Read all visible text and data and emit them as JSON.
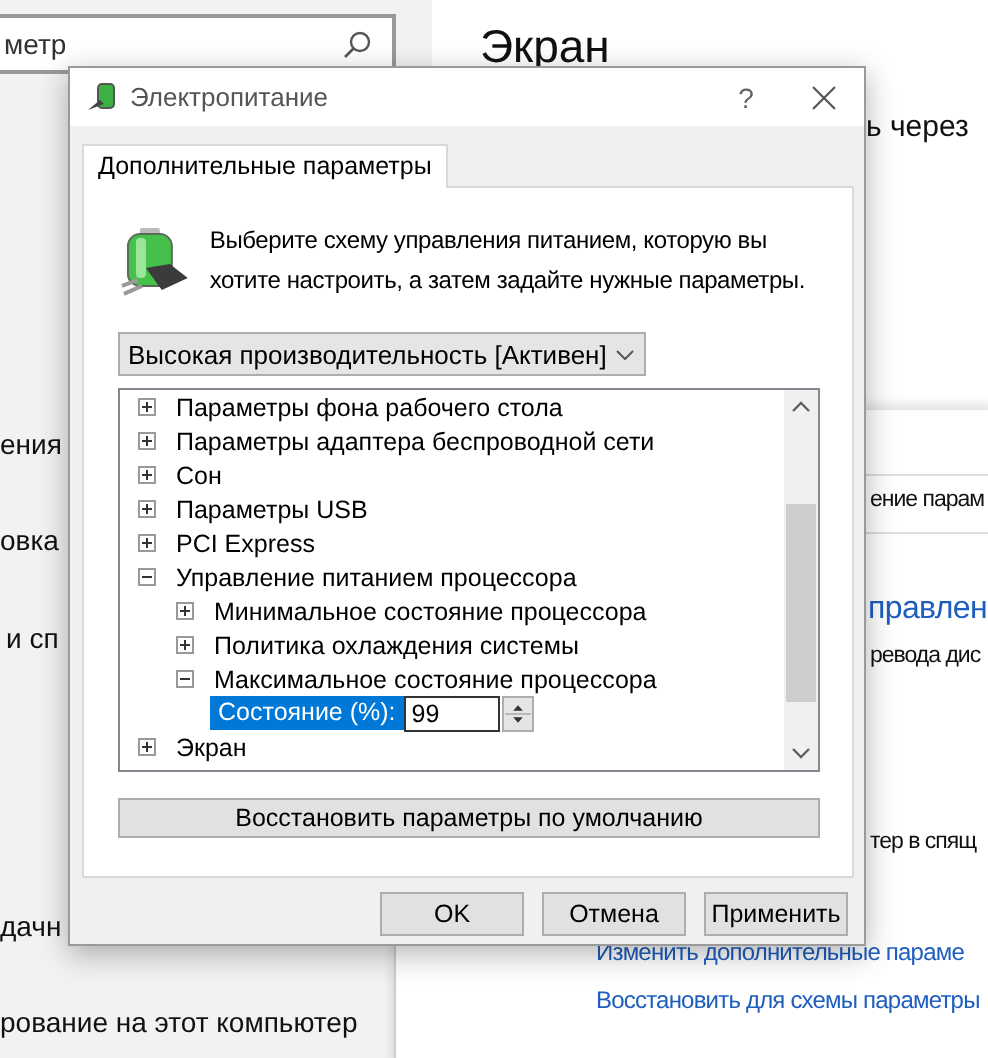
{
  "settings_window": {
    "search": {
      "value": "метр"
    },
    "sidebar_items": [
      "ения",
      "овка",
      "и сп",
      "дачн",
      "рование на этот компьютер"
    ],
    "heading": "Экран",
    "text_fragment": "ь через"
  },
  "control_panel": {
    "row_text": "ение парам",
    "heading": "правлен",
    "text_1": "ревода дис",
    "text_2": "тер в спящ",
    "links": [
      "Изменить дополнительные параме",
      "Восстановить для схемы параметры"
    ]
  },
  "dialog": {
    "title": "Электропитание",
    "help": "?",
    "tabs": [
      {
        "label": "Дополнительные параметры",
        "selected": true
      }
    ],
    "description": "Выберите схему управления питанием, которую вы хотите настроить, а затем задайте нужные параметры.",
    "plan": "Высокая производительность [Активен]",
    "tree": [
      {
        "kind": "group",
        "label": "Параметры фона рабочего стола",
        "expanded": false
      },
      {
        "kind": "group",
        "label": "Параметры адаптера беспроводной сети",
        "expanded": false
      },
      {
        "kind": "group",
        "label": "Сон",
        "expanded": false
      },
      {
        "kind": "group",
        "label": "Параметры USB",
        "expanded": false
      },
      {
        "kind": "group",
        "label": "PCI Express",
        "expanded": false
      },
      {
        "kind": "group",
        "label": "Управление питанием процессора",
        "expanded": true,
        "children": [
          {
            "kind": "group",
            "label": "Минимальное состояние процессора",
            "expanded": false
          },
          {
            "kind": "group",
            "label": "Политика охлаждения системы",
            "expanded": false
          },
          {
            "kind": "group",
            "label": "Максимальное состояние процессора",
            "expanded": true,
            "children": [
              {
                "kind": "setting",
                "label": "Состояние (%):",
                "value": "99",
                "selected": true
              }
            ]
          }
        ]
      },
      {
        "kind": "group",
        "label": "Экран",
        "expanded": false
      }
    ],
    "restore_button": "Восстановить параметры по умолчанию",
    "buttons": [
      "OK",
      "Отмена",
      "Применить"
    ]
  }
}
